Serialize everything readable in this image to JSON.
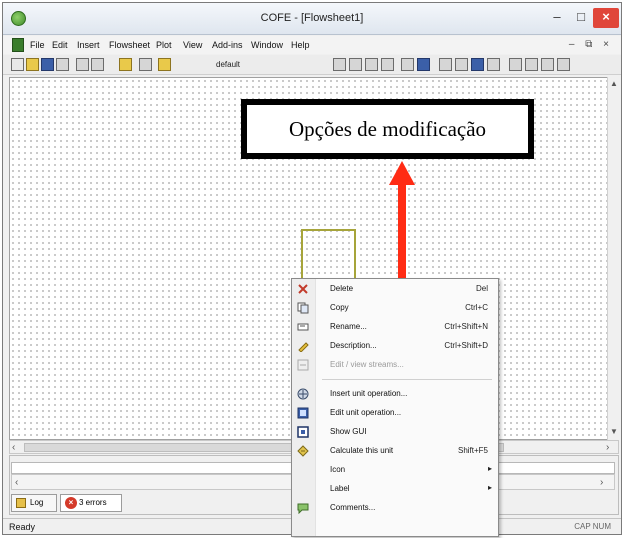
{
  "window": {
    "title": "COFE - [Flowsheet1]",
    "minimize": "–",
    "maximize": "□",
    "close": "×"
  },
  "menubar": {
    "items": [
      "File",
      "Edit",
      "Insert",
      "Flowsheet",
      "Plot",
      "View",
      "Add-ins",
      "Window",
      "Help"
    ],
    "mdi_controls": "– ⧉ ×"
  },
  "toolbar": {
    "style_value": "default"
  },
  "callout": {
    "text": "Opções de modificação",
    "arrow_color": "#ff2b14"
  },
  "context_menu": {
    "items": [
      {
        "label": "Delete",
        "shortcut": "Del",
        "icon": "delete-x-icon"
      },
      {
        "label": "Copy",
        "shortcut": "Ctrl+C",
        "icon": "copy-icon"
      },
      {
        "label": "Rename...",
        "shortcut": "Ctrl+Shift+N",
        "icon": "rename-icon"
      },
      {
        "label": "Description...",
        "shortcut": "Ctrl+Shift+D",
        "icon": "description-icon"
      },
      {
        "label": "Edit / view streams...",
        "shortcut": "",
        "icon": "streams-icon",
        "disabled": true
      },
      {
        "label": "Insert unit operation...",
        "shortcut": "",
        "icon": "insert-unit-icon"
      },
      {
        "label": "Edit unit operation...",
        "shortcut": "",
        "icon": "edit-unit-icon"
      },
      {
        "label": "Show GUI",
        "shortcut": "",
        "icon": "gui-icon"
      },
      {
        "label": "Calculate this unit",
        "shortcut": "Shift+F5",
        "icon": "calculate-icon"
      },
      {
        "label": "Icon",
        "shortcut": "",
        "submenu": true
      },
      {
        "label": "Label",
        "shortcut": "",
        "submenu": true
      },
      {
        "label": "Comments...",
        "shortcut": "",
        "icon": "comments-icon"
      }
    ],
    "submenu_glyph": "▸"
  },
  "lower_panel": {
    "tabs": [
      {
        "label": "Log",
        "icon": "log-icon"
      },
      {
        "label": "3 errors",
        "icon": "error-icon"
      }
    ]
  },
  "statusbar": {
    "text": "Ready",
    "indicators": "CAP NUM"
  },
  "colors": {
    "close_button": "#e0463a",
    "callout_border": "#000000",
    "arrow": "#ff2b14",
    "unit_block_border": "#a6a43a"
  }
}
